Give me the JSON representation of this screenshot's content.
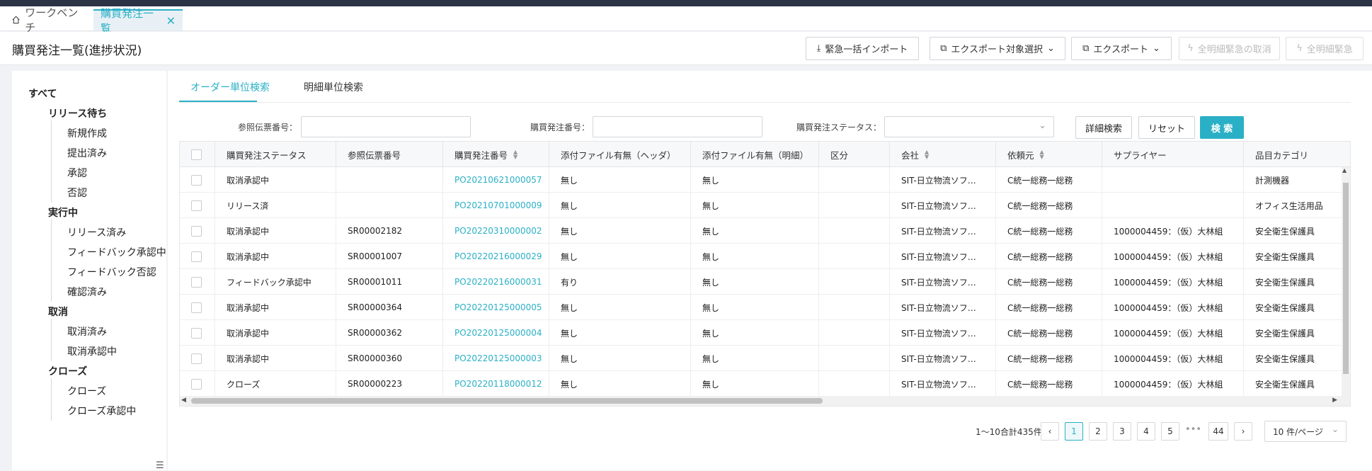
{
  "tabs": [
    {
      "label": "ワークベンチ",
      "icon": "home-icon"
    },
    {
      "label": "購買発注一覧",
      "icon": "close-icon"
    }
  ],
  "header": {
    "title": "購買発注一覧(進捗状況)",
    "buttons": [
      "緊急一括インポート",
      "エクスポート対象選択",
      "エクスポート",
      "全明細緊急の取消",
      "全明細緊急"
    ]
  },
  "tree": {
    "all": "すべて",
    "groups": [
      {
        "label": "リリース待ち",
        "items": [
          "新規作成",
          "提出済み",
          "承認",
          "否認"
        ]
      },
      {
        "label": "実行中",
        "items": [
          "リリース済み",
          "フィードバック承認中",
          "フィードバック否認",
          "確認済み"
        ]
      },
      {
        "label": "取消",
        "items": [
          "取消済み",
          "取消承認中"
        ]
      },
      {
        "label": "クローズ",
        "items": [
          "クローズ",
          "クローズ承認中"
        ]
      }
    ]
  },
  "subtabs": [
    "オーダー単位検索",
    "明細単位検索"
  ],
  "filters": {
    "ref_label": "参照伝票番号：",
    "po_label": "購買発注番号：",
    "status_label": "購買発注ステータス：",
    "detail_search": "詳細検索",
    "reset": "リセット",
    "search": "検 索"
  },
  "table": {
    "columns": [
      "購買発注ステータス",
      "参照伝票番号",
      "購買発注番号",
      "添付ファイル有無（ヘッダ）",
      "添付ファイル有無（明細）",
      "区分",
      "会社",
      "依頼元",
      "サプライヤー",
      "品目カテゴリ"
    ],
    "rows": [
      [
        "取消承認中",
        "",
        "PO20210621000057",
        "無し",
        "無し",
        "",
        "SIT-日立物流ソフ…",
        "C統一総務一総務",
        "",
        "計測機器"
      ],
      [
        "リリース済",
        "",
        "PO20210701000009",
        "無し",
        "無し",
        "",
        "SIT-日立物流ソフ…",
        "C統一総務一総務",
        "",
        "オフィス生活用品"
      ],
      [
        "取消承認中",
        "SR00002182",
        "PO20220310000002",
        "無し",
        "無し",
        "",
        "SIT-日立物流ソフ…",
        "C統一総務一総務",
        "1000004459：（仮）大林組",
        "安全衛生保護具"
      ],
      [
        "取消承認中",
        "SR00001007",
        "PO20220216000029",
        "無し",
        "無し",
        "",
        "SIT-日立物流ソフ…",
        "C統一総務一総務",
        "1000004459：（仮）大林組",
        "安全衛生保護具"
      ],
      [
        "フィードバック承認中",
        "SR00001011",
        "PO20220216000031",
        "有り",
        "無し",
        "",
        "SIT-日立物流ソフ…",
        "C統一総務一総務",
        "1000004459：（仮）大林組",
        "安全衛生保護具"
      ],
      [
        "取消承認中",
        "SR00000364",
        "PO20220125000005",
        "無し",
        "無し",
        "",
        "SIT-日立物流ソフ…",
        "C統一総務一総務",
        "1000004459：（仮）大林組",
        "安全衛生保護具"
      ],
      [
        "取消承認中",
        "SR00000362",
        "PO20220125000004",
        "無し",
        "無し",
        "",
        "SIT-日立物流ソフ…",
        "C統一総務一総務",
        "1000004459：（仮）大林組",
        "安全衛生保護具"
      ],
      [
        "取消承認中",
        "SR00000360",
        "PO20220125000003",
        "無し",
        "無し",
        "",
        "SIT-日立物流ソフ…",
        "C統一総務一総務",
        "1000004459：（仮）大林組",
        "安全衛生保護具"
      ],
      [
        "クローズ",
        "SR00000223",
        "PO20220118000012",
        "無し",
        "無し",
        "",
        "SIT-日立物流ソフ…",
        "C統一総務一総務",
        "1000004459：（仮）大林組",
        "安全衛生保護具"
      ]
    ]
  },
  "pagination": {
    "total": "1〜10合計435件",
    "pages": [
      "1",
      "2",
      "3",
      "4",
      "5"
    ],
    "ellipsis": "•••",
    "last": "44",
    "page_size": "10 件/ページ",
    "current": "1"
  },
  "colors": {
    "accent": "#2ab0c6",
    "topbar": "#2b3445"
  }
}
